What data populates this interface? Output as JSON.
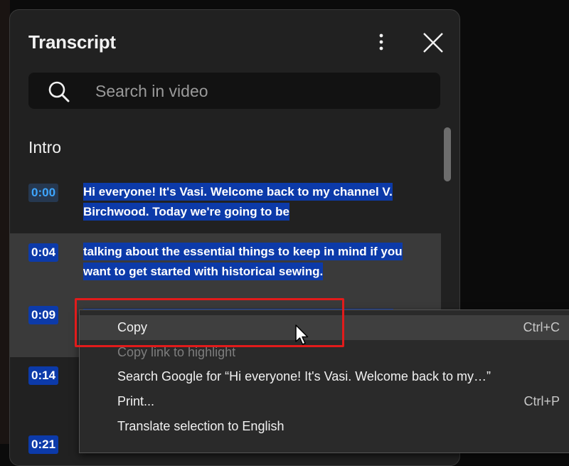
{
  "panel": {
    "title": "Transcript",
    "search_placeholder": "Search in video",
    "section_title": "Intro"
  },
  "segments": [
    {
      "time": "0:00",
      "text": "Hi everyone! It's Vasi. Welcome back to my  channel V. Birchwood. Today we're going to be"
    },
    {
      "time": "0:04",
      "text": "talking about the essential things to keep in mind  if you want to get started with historical sewing."
    },
    {
      "time": "0:09",
      "text": ""
    },
    {
      "time": "0:14",
      "text": ""
    },
    {
      "time": "0:21",
      "text": ""
    }
  ],
  "context_menu": {
    "items": [
      {
        "label": "Copy",
        "shortcut": "Ctrl+C"
      },
      {
        "label": "Copy link to highlight",
        "shortcut": ""
      },
      {
        "label": "Search Google for “Hi everyone! It's Vasi. Welcome back to my…”",
        "shortcut": ""
      },
      {
        "label": "Print...",
        "shortcut": "Ctrl+P"
      },
      {
        "label": "Translate selection to English",
        "shortcut": ""
      }
    ]
  },
  "colors": {
    "panel_bg": "#212121",
    "selection": "#0c3aa9",
    "annotation_box": "#e21b1b"
  },
  "icons": [
    "more-vertical-icon",
    "close-icon",
    "search-icon",
    "mouse-pointer-icon"
  ]
}
